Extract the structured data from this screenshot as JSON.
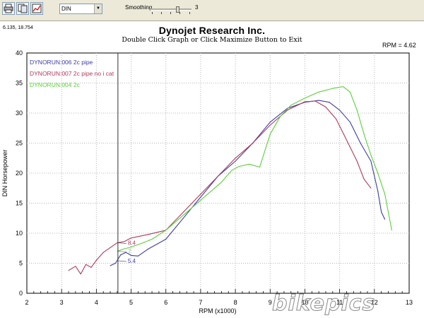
{
  "toolbar": {
    "buttons": [
      {
        "icon": "print-icon"
      },
      {
        "icon": "copy-icon"
      },
      {
        "icon": "graph-settings-icon"
      }
    ],
    "units_select": "DIN",
    "smoothing_label": "Smoothing",
    "smoothing_value": "3",
    "smoothing_level": 3
  },
  "header": {
    "coords": "6.135, 18.754",
    "title": "Dynojet Research Inc.",
    "subtitle": "Double Click Graph or Click Maximize Button to Exit",
    "rpm_readout": "RPM = 4.62"
  },
  "watermark": "bikepics",
  "chart_data": {
    "type": "line",
    "title": "",
    "xlabel": "RPM (x1000)",
    "ylabel": "DIN Horsepower",
    "xlim": [
      2,
      13
    ],
    "ylim": [
      0,
      40
    ],
    "x_ticks": [
      "2",
      "3",
      "4",
      "5",
      "6",
      "7",
      "8",
      "9",
      "10",
      "11",
      "12",
      "13"
    ],
    "y_ticks": [
      "0",
      "5",
      "10",
      "15",
      "20",
      "25",
      "30",
      "35",
      "40"
    ],
    "grid": true,
    "legend_position": "top-left",
    "cursor_rpm": 4.62,
    "cursor_labels": [
      "8.4",
      "7",
      "5.4"
    ],
    "series": [
      {
        "name": "DYNORUN:006   2c pipe",
        "color": "#3c3ca8",
        "x": [
          4.4,
          4.55,
          4.7,
          4.85,
          5.0,
          5.2,
          5.5,
          6.0,
          6.5,
          7.0,
          7.5,
          8.0,
          8.5,
          9.0,
          9.5,
          10.0,
          10.4,
          10.7,
          11.0,
          11.3,
          11.6,
          11.9,
          12.1,
          12.2,
          12.3
        ],
        "y": [
          4.6,
          5.0,
          6.4,
          6.8,
          6.3,
          6.2,
          7.4,
          9.0,
          12.5,
          16.0,
          19.5,
          22.0,
          25.0,
          28.5,
          30.8,
          31.8,
          32.1,
          31.8,
          30.5,
          28.5,
          25.0,
          22.0,
          17.0,
          13.5,
          12.3
        ]
      },
      {
        "name": "DYNORUN:007   2c pipe no  i cat",
        "color": "#b03a5a",
        "x": [
          3.2,
          3.4,
          3.55,
          3.7,
          3.85,
          4.0,
          4.2,
          4.4,
          4.6,
          4.8,
          5.0,
          5.5,
          6.0,
          6.5,
          7.0,
          7.5,
          8.0,
          8.5,
          9.0,
          9.5,
          10.0,
          10.3,
          10.6,
          10.9,
          11.2,
          11.5,
          11.7,
          11.9
        ],
        "y": [
          3.8,
          4.5,
          3.2,
          4.8,
          4.3,
          5.5,
          6.8,
          7.6,
          8.4,
          8.6,
          9.2,
          9.8,
          10.5,
          13.5,
          16.5,
          19.5,
          22.5,
          25.0,
          28.0,
          30.5,
          31.9,
          32.0,
          31.0,
          29.0,
          25.5,
          22.0,
          19.0,
          17.5
        ]
      },
      {
        "name": "DYNORUN:004   2c",
        "color": "#5ccf3c",
        "x": [
          4.6,
          4.8,
          5.0,
          5.3,
          5.6,
          6.0,
          6.4,
          6.8,
          7.2,
          7.6,
          7.9,
          8.1,
          8.4,
          8.7,
          9.0,
          9.3,
          9.6,
          10.0,
          10.4,
          10.8,
          11.1,
          11.3,
          11.5,
          11.7,
          11.9,
          12.1,
          12.3,
          12.5
        ],
        "y": [
          7.0,
          7.4,
          7.7,
          8.3,
          9.0,
          10.5,
          12.5,
          14.5,
          16.5,
          18.5,
          20.5,
          21.1,
          21.5,
          21.0,
          26.5,
          29.5,
          31.3,
          32.5,
          33.5,
          34.1,
          34.4,
          33.5,
          30.5,
          26.5,
          23.0,
          20.0,
          16.5,
          10.5
        ]
      }
    ]
  }
}
